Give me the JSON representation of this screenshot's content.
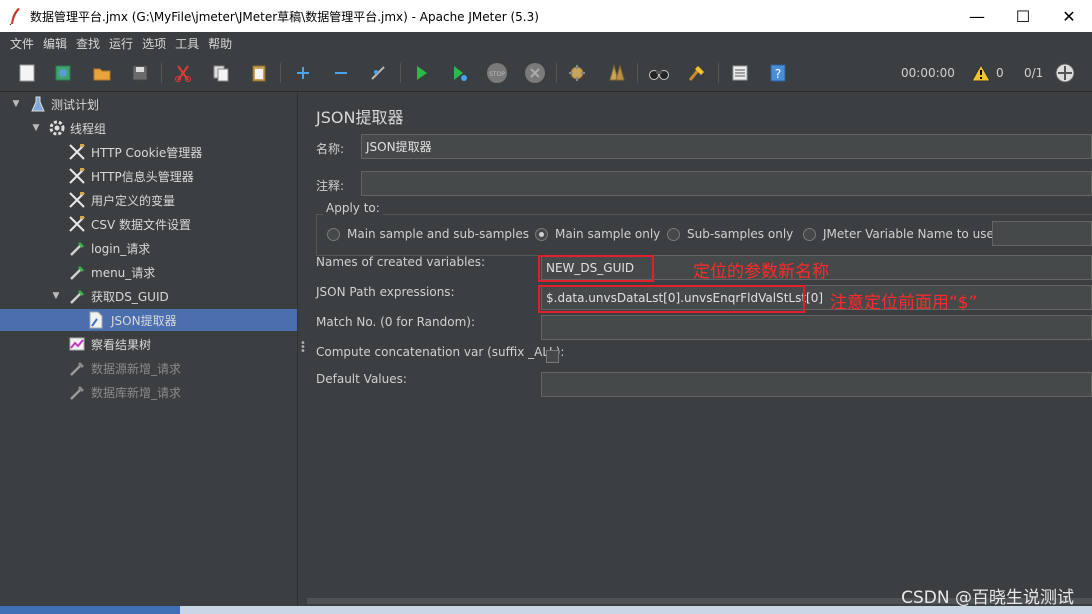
{
  "window": {
    "title": "数据管理平台.jmx (G:\\MyFile\\jmeter\\JMeter草稿\\数据管理平台.jmx) - Apache JMeter (5.3)",
    "minimize": "—",
    "maximize": "☐",
    "close": "✕"
  },
  "menu": {
    "items": [
      "文件",
      "编辑",
      "查找",
      "运行",
      "选项",
      "工具",
      "帮助"
    ]
  },
  "toolbar": {
    "icons": [
      "new-icon",
      "templates-icon",
      "open-icon",
      "save-icon",
      "cut-icon",
      "copy-icon",
      "paste-icon",
      "expand-icon",
      "collapse-icon",
      "toggle-icon",
      "start-icon",
      "start-no-pause-icon",
      "stop-icon",
      "shutdown-icon",
      "clear-icon",
      "clear-all-icon",
      "search-icon",
      "reset-search-icon",
      "function-helper-icon",
      "help-icon"
    ],
    "timer": "00:00:00",
    "warning_count": "0",
    "threads": "0/1"
  },
  "tree": {
    "items": [
      {
        "label": "测试计划",
        "icon": "test-plan-icon"
      },
      {
        "label": "线程组",
        "icon": "thread-group-icon"
      },
      {
        "label": "HTTP Cookie管理器",
        "icon": "config-tool-icon"
      },
      {
        "label": "HTTP信息头管理器",
        "icon": "config-tool-icon"
      },
      {
        "label": "用户定义的变量",
        "icon": "config-tool-icon"
      },
      {
        "label": "CSV 数据文件设置",
        "icon": "config-tool-icon"
      },
      {
        "label": "login_请求",
        "icon": "sampler-pipette-icon"
      },
      {
        "label": "menu_请求",
        "icon": "sampler-pipette-icon"
      },
      {
        "label": "获取DS_GUID",
        "icon": "sampler-pipette-icon"
      },
      {
        "label": "JSON提取器",
        "icon": "extractor-doc-icon"
      },
      {
        "label": "察看结果树",
        "icon": "results-tree-icon"
      },
      {
        "label": "数据源新增_请求",
        "icon": "sampler-pipette-icon"
      },
      {
        "label": "数据库新增_请求",
        "icon": "sampler-pipette-icon"
      }
    ]
  },
  "panel": {
    "title": "JSON提取器",
    "name_label": "名称:",
    "name_value": "JSON提取器",
    "comment_label": "注释:",
    "comment_value": "",
    "apply_to_label": "Apply to:",
    "apply_options": [
      "Main sample and sub-samples",
      "Main sample only",
      "Sub-samples only",
      "JMeter Variable Name to use"
    ],
    "apply_selected": "Main sample only",
    "var_names_label": "Names of created variables:",
    "var_names_value": "NEW_DS_GUID",
    "json_path_label": "JSON Path expressions:",
    "json_path_value": "$.data.unvsDataLst[0].unvsEnqrFldValStLst[0]",
    "match_no_label": "Match No. (0 for Random):",
    "match_no_value": "",
    "concat_label": "Compute concatenation var (suffix _ALL):",
    "concat_checked": false,
    "default_label": "Default Values:",
    "default_value": ""
  },
  "annotations": {
    "var_note": "定位的参数新名称",
    "path_note": "注意定位前面用“$”"
  },
  "watermark": "CSDN @百晓生说测试",
  "colors": {
    "background": "#3c3f41",
    "selection": "#4b6eaf",
    "annotation_red": "#ff2a2a"
  }
}
